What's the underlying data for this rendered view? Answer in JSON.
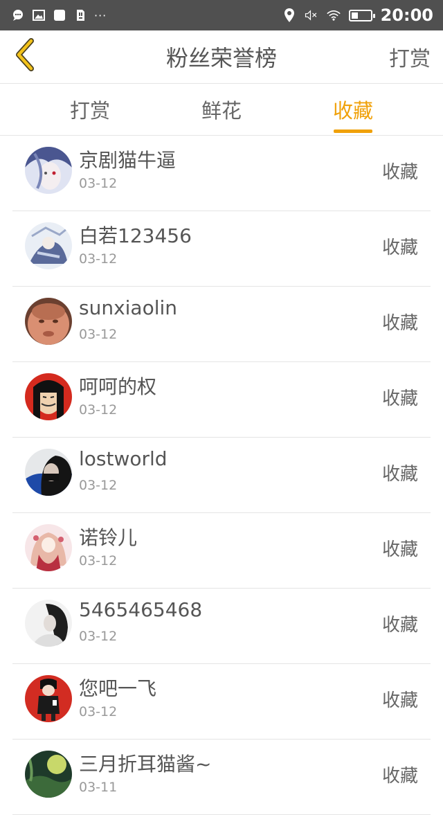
{
  "status_bar": {
    "time": "20:00",
    "overflow": "···"
  },
  "header": {
    "title": "粉丝荣誉榜",
    "action": "打赏"
  },
  "tabs": [
    {
      "label": "打赏",
      "active": false
    },
    {
      "label": "鲜花",
      "active": false
    },
    {
      "label": "收藏",
      "active": true
    }
  ],
  "colors": {
    "accent": "#f0a10a",
    "status_bar": "#505050"
  },
  "rows": [
    {
      "name": "京剧猫牛逼",
      "date": "03-12",
      "action": "收藏"
    },
    {
      "name": "白若123456",
      "date": "03-12",
      "action": "收藏"
    },
    {
      "name": "sunxiaolin",
      "date": "03-12",
      "action": "收藏"
    },
    {
      "name": "呵呵的权",
      "date": "03-12",
      "action": "收藏"
    },
    {
      "name": "lostworld",
      "date": "03-12",
      "action": "收藏"
    },
    {
      "name": "诺铃儿",
      "date": "03-12",
      "action": "收藏"
    },
    {
      "name": "5465465468",
      "date": "03-12",
      "action": "收藏"
    },
    {
      "name": "您吧一飞",
      "date": "03-12",
      "action": "收藏"
    },
    {
      "name": "三月折耳猫酱~",
      "date": "03-11",
      "action": "收藏"
    }
  ]
}
